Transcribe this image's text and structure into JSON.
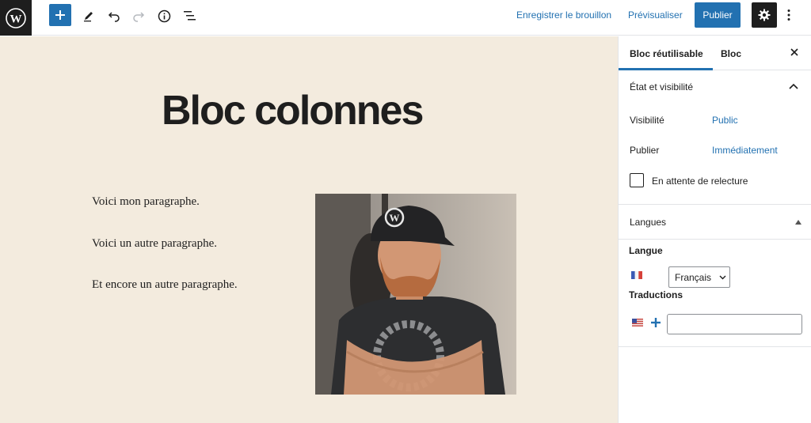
{
  "toolbar": {
    "save_draft": "Enregistrer le brouillon",
    "preview": "Prévisualiser",
    "publish": "Publier"
  },
  "post": {
    "title": "Bloc colonnes",
    "paragraphs": [
      "Voici mon paragraphe.",
      "Voici un autre paragraphe.",
      "Et encore un autre paragraphe."
    ]
  },
  "sidebar": {
    "tabs": [
      "Bloc réutilisable",
      "Bloc"
    ],
    "status_panel": {
      "title": "État et visibilité",
      "visibility_label": "Visibilité",
      "visibility_value": "Public",
      "publish_label": "Publier",
      "publish_value": "Immédiatement",
      "pending_review": "En attente de relecture"
    },
    "languages_panel": {
      "title": "Langues",
      "language_label": "Langue",
      "language_value": "Français",
      "translations_label": "Traductions"
    }
  },
  "colors": {
    "accent": "#2271b1",
    "dark": "#1e1e1e",
    "canvas_bg": "#f3ebde"
  }
}
